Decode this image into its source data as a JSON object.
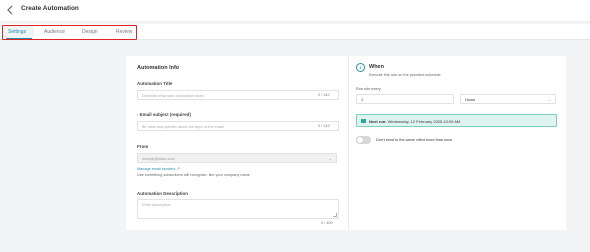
{
  "header": {
    "title": "Create Automation",
    "back_icon": "arrow-left-icon"
  },
  "tabs": [
    {
      "label": "Settings",
      "active": true
    },
    {
      "label": "Audience",
      "active": false
    },
    {
      "label": "Design",
      "active": false
    },
    {
      "label": "Review",
      "active": false
    }
  ],
  "automation_info": {
    "title": "Automation Info",
    "automation_title": {
      "label": "Automation Title",
      "placeholder": "Describe what your automation does",
      "counter": "0 / 142"
    },
    "email_subject": {
      "label": "Email subject (required)",
      "placeholder": "Be clear and specific about the topic of the email",
      "counter": "0 / 142"
    },
    "from": {
      "label": "From",
      "value": "noreply@zebu.com",
      "link": "Manage email senders",
      "helper": "Use something subscribers will recognize, like your company name"
    },
    "description": {
      "label": "Automation Description",
      "placeholder": "Enter description",
      "counter": "0 / 400"
    }
  },
  "when": {
    "step": "1",
    "title": "When",
    "subtitle": "Execute this rule on the provided schedule",
    "run_rule_label": "Run rule every",
    "interval_value": "1",
    "interval_unit": "Hours",
    "next_run_label": "Next run:",
    "next_run_value": "Wednesday, 12 February 2025 10:00 AM",
    "toggle_label": "Don't send to the same client more than once",
    "toggle_on": false
  },
  "colors": {
    "accent": "#2b8aa8",
    "highlight": "#e02424",
    "success_bg": "#dff3f1"
  }
}
